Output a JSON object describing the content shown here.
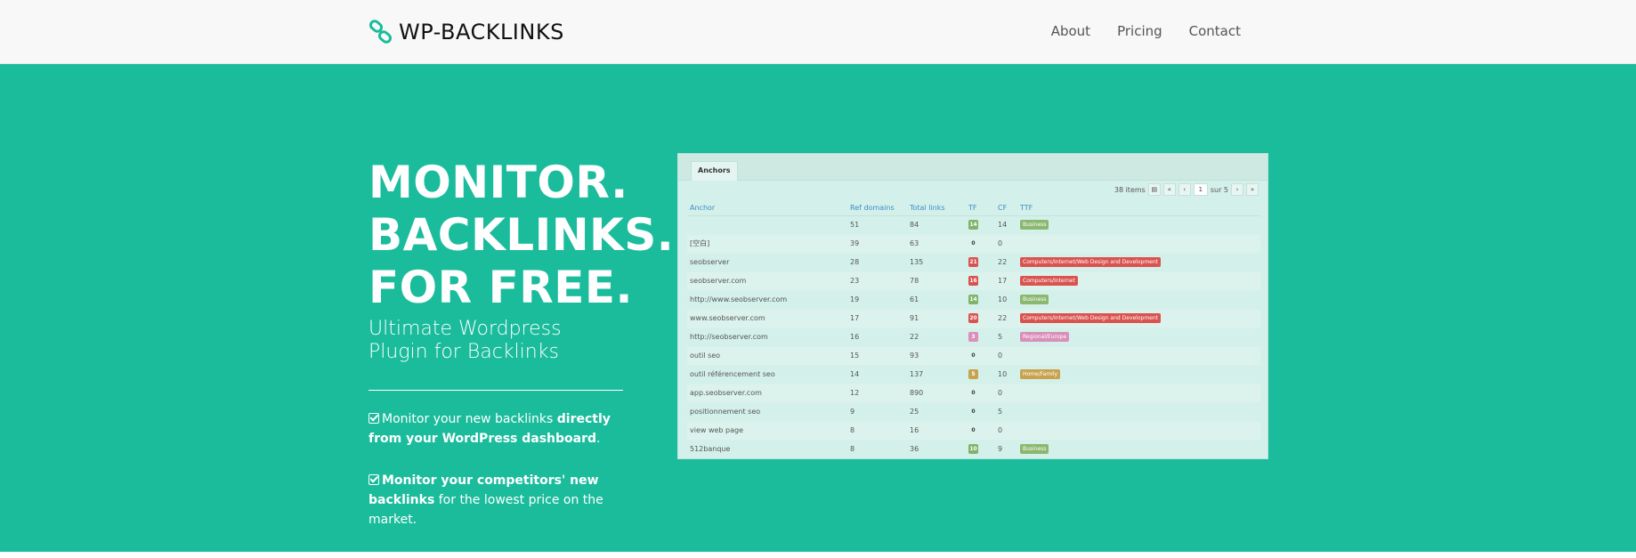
{
  "brand": {
    "name": "WP-BACKLINKS",
    "logo_icon": "chain-link-icon"
  },
  "nav": {
    "items": [
      "About",
      "Pricing",
      "Contact"
    ]
  },
  "hero": {
    "headline": [
      "MONITOR.",
      "BACKLINKS.",
      "FOR FREE."
    ],
    "subheadline": [
      "Ultimate Wordpress",
      "Plugin for Backlinks"
    ],
    "features": [
      {
        "icon": "check-square-icon",
        "text": "Monitor your new backlinks ",
        "bold": "directly from your WordPress dashboard",
        "after": "."
      },
      {
        "icon": "check-square-icon",
        "text": "",
        "bold": "Monitor your competitors' new backlinks",
        "after": " for the lowest price on the market."
      }
    ]
  },
  "screenshot": {
    "tab": "Anchors",
    "pagination": {
      "items_label": "38 items",
      "first": "«",
      "prev": "‹",
      "page": "1",
      "of_label": "sur 5",
      "next": "›",
      "last": "»"
    },
    "columns": [
      "Anchor",
      "Ref domains",
      "Total links",
      "TF",
      "CF",
      "TTF"
    ],
    "rows": [
      {
        "anchor": "",
        "ref": "51",
        "total": "84",
        "tf": "14",
        "cf": "14",
        "ttf": "Business"
      },
      {
        "anchor": "[空白]",
        "ref": "39",
        "total": "63",
        "tf": "0",
        "cf": "0",
        "ttf": ""
      },
      {
        "anchor": "seobserver",
        "ref": "28",
        "total": "135",
        "tf": "21",
        "cf": "22",
        "ttf": "Computers/Internet/Web Design and Development"
      },
      {
        "anchor": "seobserver.com",
        "ref": "23",
        "total": "78",
        "tf": "16",
        "cf": "17",
        "ttf": "Computers/Internet"
      },
      {
        "anchor": "http://www.seobserver.com",
        "ref": "19",
        "total": "61",
        "tf": "14",
        "cf": "10",
        "ttf": "Business"
      },
      {
        "anchor": "www.seobserver.com",
        "ref": "17",
        "total": "91",
        "tf": "20",
        "cf": "22",
        "ttf": "Computers/Internet/Web Design and Development"
      },
      {
        "anchor": "http://seobserver.com",
        "ref": "16",
        "total": "22",
        "tf": "3",
        "cf": "5",
        "ttf": "Regional/Europe"
      },
      {
        "anchor": "outil seo",
        "ref": "15",
        "total": "93",
        "tf": "0",
        "cf": "0",
        "ttf": ""
      },
      {
        "anchor": "outil référencement seo",
        "ref": "14",
        "total": "137",
        "tf": "5",
        "cf": "10",
        "ttf": "Home/Family"
      },
      {
        "anchor": "app.seobserver.com",
        "ref": "12",
        "total": "890",
        "tf": "0",
        "cf": "0",
        "ttf": ""
      },
      {
        "anchor": "positionnement seo",
        "ref": "9",
        "total": "25",
        "tf": "0",
        "cf": "5",
        "ttf": ""
      },
      {
        "anchor": "view web page",
        "ref": "8",
        "total": "16",
        "tf": "0",
        "cf": "0",
        "ttf": ""
      },
      {
        "anchor": "512banque",
        "ref": "8",
        "total": "36",
        "tf": "10",
        "cf": "9",
        "ttf": "Business"
      }
    ],
    "colors": {
      "hero_bg": "#1abc9c",
      "business": "#8bb870",
      "computers": "#d9534f",
      "regional": "#d98fb8",
      "home": "#c9a24e",
      "tf_green": "#7fb46a",
      "tf_red": "#d9534f",
      "tf_pink": "#d98fb8",
      "tf_orange": "#c9a24e"
    }
  }
}
